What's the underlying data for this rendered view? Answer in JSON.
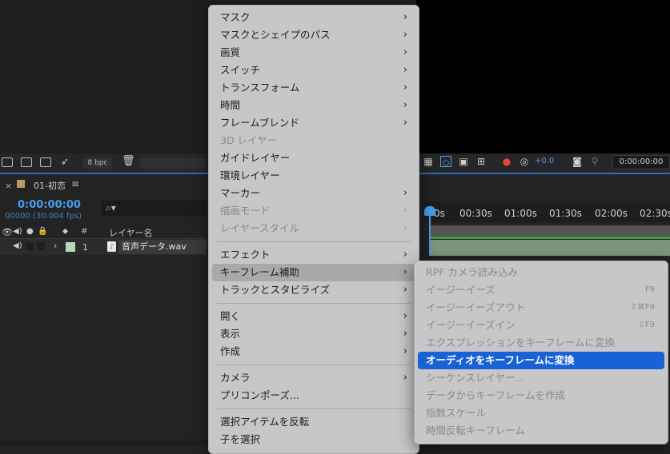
{
  "toolbar": {
    "bpc_label": "8 bpc",
    "exposure_value": "+0.0",
    "timecode": "0:00:00:00"
  },
  "timeline": {
    "tab_close": "×",
    "tab_title": "01-初恋",
    "tab_menu": "≡",
    "current_time": "0:00:00:00",
    "frames_fps": "00000 (30.004 fps)",
    "search_icon": "⌕▾",
    "columns": {
      "hash": "#",
      "layer_name": "レイヤー名"
    },
    "ruler": [
      "0s",
      "00:30s",
      "01:00s",
      "01:30s",
      "02:00s",
      "02:30s"
    ],
    "layer": {
      "number": "1",
      "name": "音声データ.wav"
    }
  },
  "main_menu": {
    "items": [
      {
        "label": "マスク",
        "submenu": true,
        "disabled": false
      },
      {
        "label": "マスクとシェイプのパス",
        "submenu": true,
        "disabled": false
      },
      {
        "label": "画質",
        "submenu": true,
        "disabled": false
      },
      {
        "label": "スイッチ",
        "submenu": true,
        "disabled": false
      },
      {
        "label": "トランスフォーム",
        "submenu": true,
        "disabled": false
      },
      {
        "label": "時間",
        "submenu": true,
        "disabled": false
      },
      {
        "label": "フレームブレンド",
        "submenu": true,
        "disabled": false
      },
      {
        "label": "3D レイヤー",
        "submenu": false,
        "disabled": true
      },
      {
        "label": "ガイドレイヤー",
        "submenu": false,
        "disabled": false
      },
      {
        "label": "環境レイヤー",
        "submenu": false,
        "disabled": false
      },
      {
        "label": "マーカー",
        "submenu": true,
        "disabled": false
      },
      {
        "label": "描画モード",
        "submenu": true,
        "disabled": true
      },
      {
        "label": "レイヤースタイル",
        "submenu": true,
        "disabled": true
      },
      {
        "label": "エフェクト",
        "submenu": true,
        "disabled": false
      },
      {
        "label": "キーフレーム補助",
        "submenu": true,
        "disabled": false,
        "selected": true
      },
      {
        "label": "トラックとスタビライズ",
        "submenu": true,
        "disabled": false
      },
      {
        "label": "開く",
        "submenu": true,
        "disabled": false
      },
      {
        "label": "表示",
        "submenu": true,
        "disabled": false
      },
      {
        "label": "作成",
        "submenu": true,
        "disabled": false
      },
      {
        "label": "カメラ",
        "submenu": true,
        "disabled": false
      },
      {
        "label": "プリコンポーズ...",
        "submenu": false,
        "disabled": false
      },
      {
        "label": "選択アイテムを反転",
        "submenu": false,
        "disabled": false
      },
      {
        "label": "子を選択",
        "submenu": false,
        "disabled": false
      }
    ]
  },
  "sub_menu": {
    "items": [
      {
        "label": "RPF カメラ読み込み",
        "shortcut": "",
        "disabled": true
      },
      {
        "label": "イージーイーズ",
        "shortcut": "F9",
        "disabled": true
      },
      {
        "label": "イージーイーズアウト",
        "shortcut": "⇧⌘F9",
        "disabled": true
      },
      {
        "label": "イージーイーズイン",
        "shortcut": "⇧F9",
        "disabled": true
      },
      {
        "label": "エクスプレッションをキーフレームに変換",
        "shortcut": "",
        "disabled": true
      },
      {
        "label": "オーディオをキーフレームに変換",
        "shortcut": "",
        "disabled": false,
        "highlighted": true
      },
      {
        "label": "シーケンスレイヤー...",
        "shortcut": "",
        "disabled": true
      },
      {
        "label": "データからキーフレームを作成",
        "shortcut": "",
        "disabled": true
      },
      {
        "label": "指数スケール",
        "shortcut": "",
        "disabled": true
      },
      {
        "label": "時間反転キーフレーム",
        "shortcut": "",
        "disabled": true
      }
    ]
  }
}
